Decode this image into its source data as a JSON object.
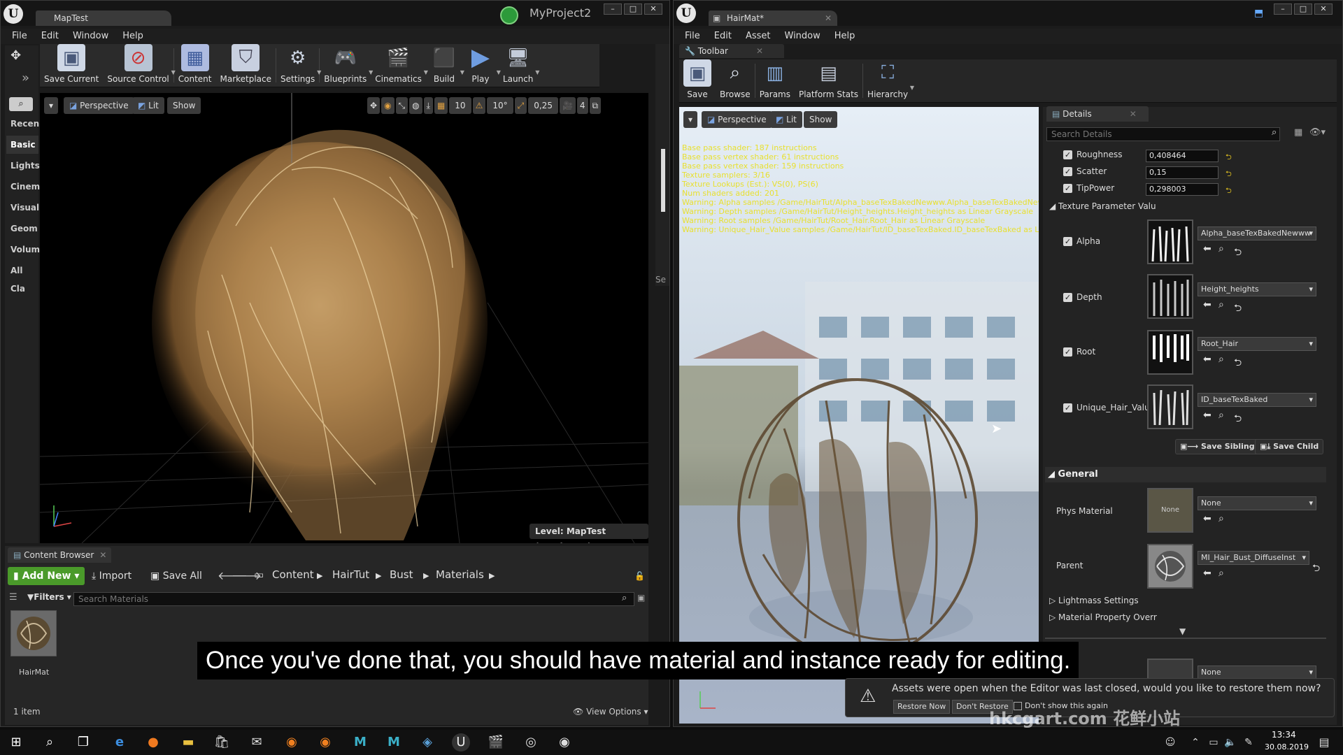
{
  "left_window": {
    "tab_title": "MapTest",
    "project_name": "MyProject2",
    "menu": [
      "File",
      "Edit",
      "Window",
      "Help"
    ],
    "toolbar": [
      "Save Current",
      "Source Control",
      "Content",
      "Marketplace",
      "Settings",
      "Blueprints",
      "Cinematics",
      "Build",
      "Play",
      "Launch"
    ],
    "viewport": {
      "view_mode": "Perspective",
      "lit": "Lit",
      "show": "Show",
      "grid_snap": "10",
      "rot_snap": "10°",
      "scale_snap": "0,25",
      "camera_speed": "4",
      "level_label": "Level:  MapTest (Persistent)"
    },
    "place_modes": {
      "search_icon": "search-icon",
      "tabs": [
        "Recen",
        "Basic",
        "Lights",
        "Cinem",
        "Visual",
        "Geom",
        "Volum",
        "All Cla"
      ]
    },
    "side_label": "Se"
  },
  "content_browser": {
    "tab": "Content Browser",
    "add_new": "Add New",
    "import": "Import",
    "save_all": "Save All",
    "path": [
      "Content",
      "HairTut",
      "Bust",
      "Materials"
    ],
    "filters": "Filters",
    "search_placeholder": "Search Materials",
    "asset_name": "HairMat",
    "item_count": "1 item",
    "view_options": "View Options"
  },
  "right_window": {
    "tab_title": "HairMat*",
    "menu": [
      "File",
      "Edit",
      "Asset",
      "Window",
      "Help"
    ],
    "toolbar_tab": "Toolbar",
    "toolbar": [
      "Save",
      "Browse",
      "Params",
      "Platform Stats",
      "Hierarchy"
    ],
    "viewport": {
      "view_mode": "Perspective",
      "lit": "Lit",
      "show": "Show"
    },
    "stats": [
      "Base pass shader: 187 instructions",
      "Base pass vertex shader: 61 instructions",
      "Base pass vertex shader: 159 instructions",
      "Texture samplers: 3/16",
      "Texture Lookups (Est.): VS(0), PS(6)",
      "Num shaders added: 201",
      "Warning: Alpha samples /Game/HairTut/Alpha_baseTexBakedNewww.Alpha_baseTexBakedNewww as",
      "Warning: Depth samples /Game/HairTut/Height_heights.Height_heights as Linear Grayscale",
      "Warning: Root samples /Game/HairTut/Root_Hair.Root_Hair as Linear Grayscale",
      "Warning: Unique_Hair_Value samples /Game/HairTut/ID_baseTexBaked.ID_baseTexBaked as Linear Gr"
    ],
    "stats_color": "#e8e030"
  },
  "details": {
    "tab": "Details",
    "search_placeholder": "Search Details",
    "scalar_params": [
      {
        "name": "Roughness",
        "value": "0,408464"
      },
      {
        "name": "Scatter",
        "value": "0,15"
      },
      {
        "name": "TipPower",
        "value": "0,298003"
      }
    ],
    "texture_section": "Texture Parameter Valu",
    "texture_params": [
      {
        "name": "Alpha",
        "texture": "Alpha_baseTexBakedNewww"
      },
      {
        "name": "Depth",
        "texture": "Height_heights"
      },
      {
        "name": "Root",
        "texture": "Root_Hair"
      },
      {
        "name": "Unique_Hair_Value",
        "texture": "ID_baseTexBaked"
      }
    ],
    "save_sibling": "Save Sibling",
    "save_child": "Save Child",
    "general_section": "General",
    "phys_material_label": "Phys Material",
    "phys_material_value": "None",
    "phys_thumb_text": "None",
    "parent_label": "Parent",
    "parent_value": "MI_Hair_Bust_DiffuseInst",
    "lightmass": "Lightmass Settings",
    "material_property": "Material Property Overr",
    "extra_none": "None"
  },
  "notification": {
    "message": "Assets were open when the Editor was last closed, would you like to restore them now?",
    "restore": "Restore Now",
    "dont_restore": "Don't Restore",
    "dont_show": "Don't show this again"
  },
  "subtitle": "Once you've done that, you should have material and instance ready for editing.",
  "watermark": "hkcgart.com  花鲜小站",
  "taskbar": {
    "time": "13:34",
    "date": "30.08.2019"
  }
}
